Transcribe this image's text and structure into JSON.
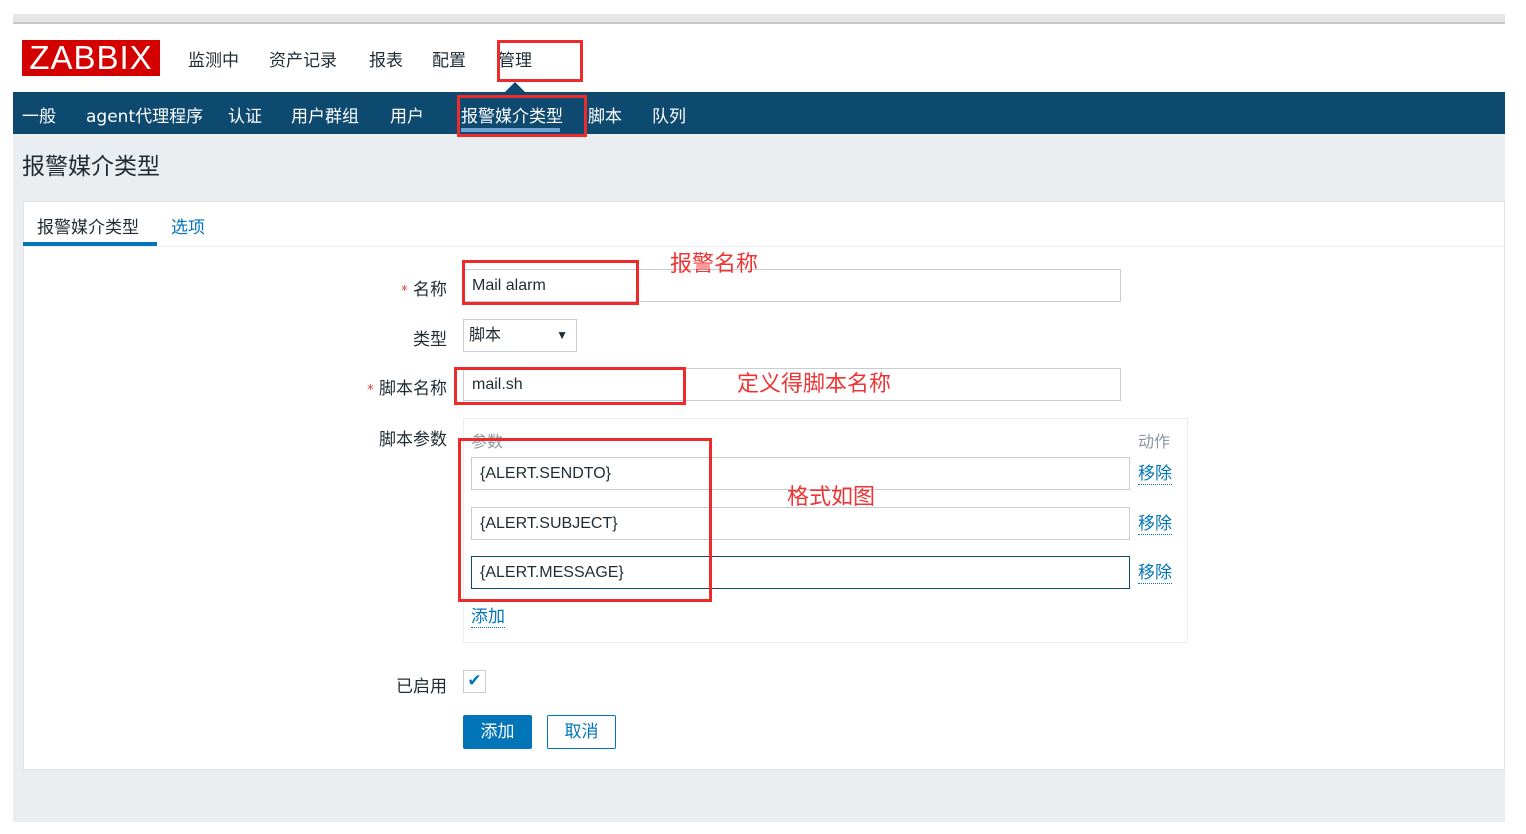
{
  "logo": "ZABBIX",
  "main_nav": [
    "监测中",
    "资产记录",
    "报表",
    "配置",
    "管理"
  ],
  "sub_nav": [
    "一般",
    "agent代理程序",
    "认证",
    "用户群组",
    "用户",
    "报警媒介类型",
    "脚本",
    "队列"
  ],
  "page_title": "报警媒介类型",
  "tabs": [
    "报警媒介类型",
    "选项"
  ],
  "form": {
    "name_label": "名称",
    "name_value": "Mail alarm",
    "type_label": "类型",
    "type_value": "脚本",
    "script_label": "脚本名称",
    "script_value": "mail.sh",
    "params_label": "脚本参数",
    "params_col": "参数",
    "action_col": "动作",
    "params": [
      "{ALERT.SENDTO}",
      "{ALERT.SUBJECT}",
      "{ALERT.MESSAGE}"
    ],
    "remove_label": "移除",
    "add_param_label": "添加",
    "enabled_label": "已启用",
    "enabled": true,
    "submit_label": "添加",
    "cancel_label": "取消",
    "required_mark": "*"
  },
  "annotations": [
    "报警名称",
    "定义得脚本名称",
    "格式如图"
  ],
  "colors": {
    "brand": "#d40000",
    "nav": "#0e4a70",
    "accent": "#0275b8",
    "annotation": "#ee2b2b"
  }
}
